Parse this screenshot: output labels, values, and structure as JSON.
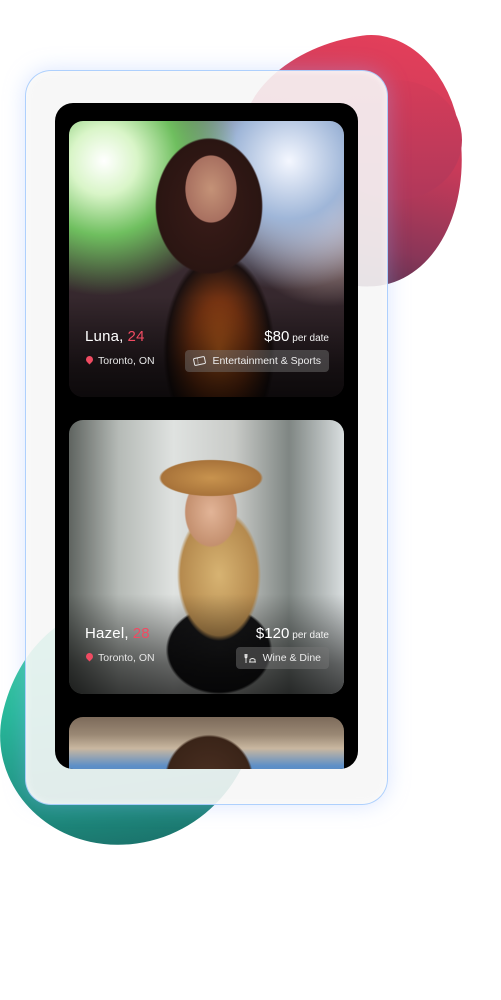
{
  "profiles": [
    {
      "name": "Luna,",
      "age": "24",
      "location": "Toronto, ON",
      "price": "$80",
      "price_unit": "per date",
      "category": "Entertainment & Sports",
      "category_icon": "ticket-icon"
    },
    {
      "name": "Hazel,",
      "age": "28",
      "location": "Toronto, ON",
      "price": "$120",
      "price_unit": "per date",
      "category": "Wine & Dine",
      "category_icon": "dining-icon"
    }
  ],
  "colors": {
    "accent": "#f04b62",
    "blob_red": "#e8405a",
    "blob_green": "#28b89a"
  }
}
